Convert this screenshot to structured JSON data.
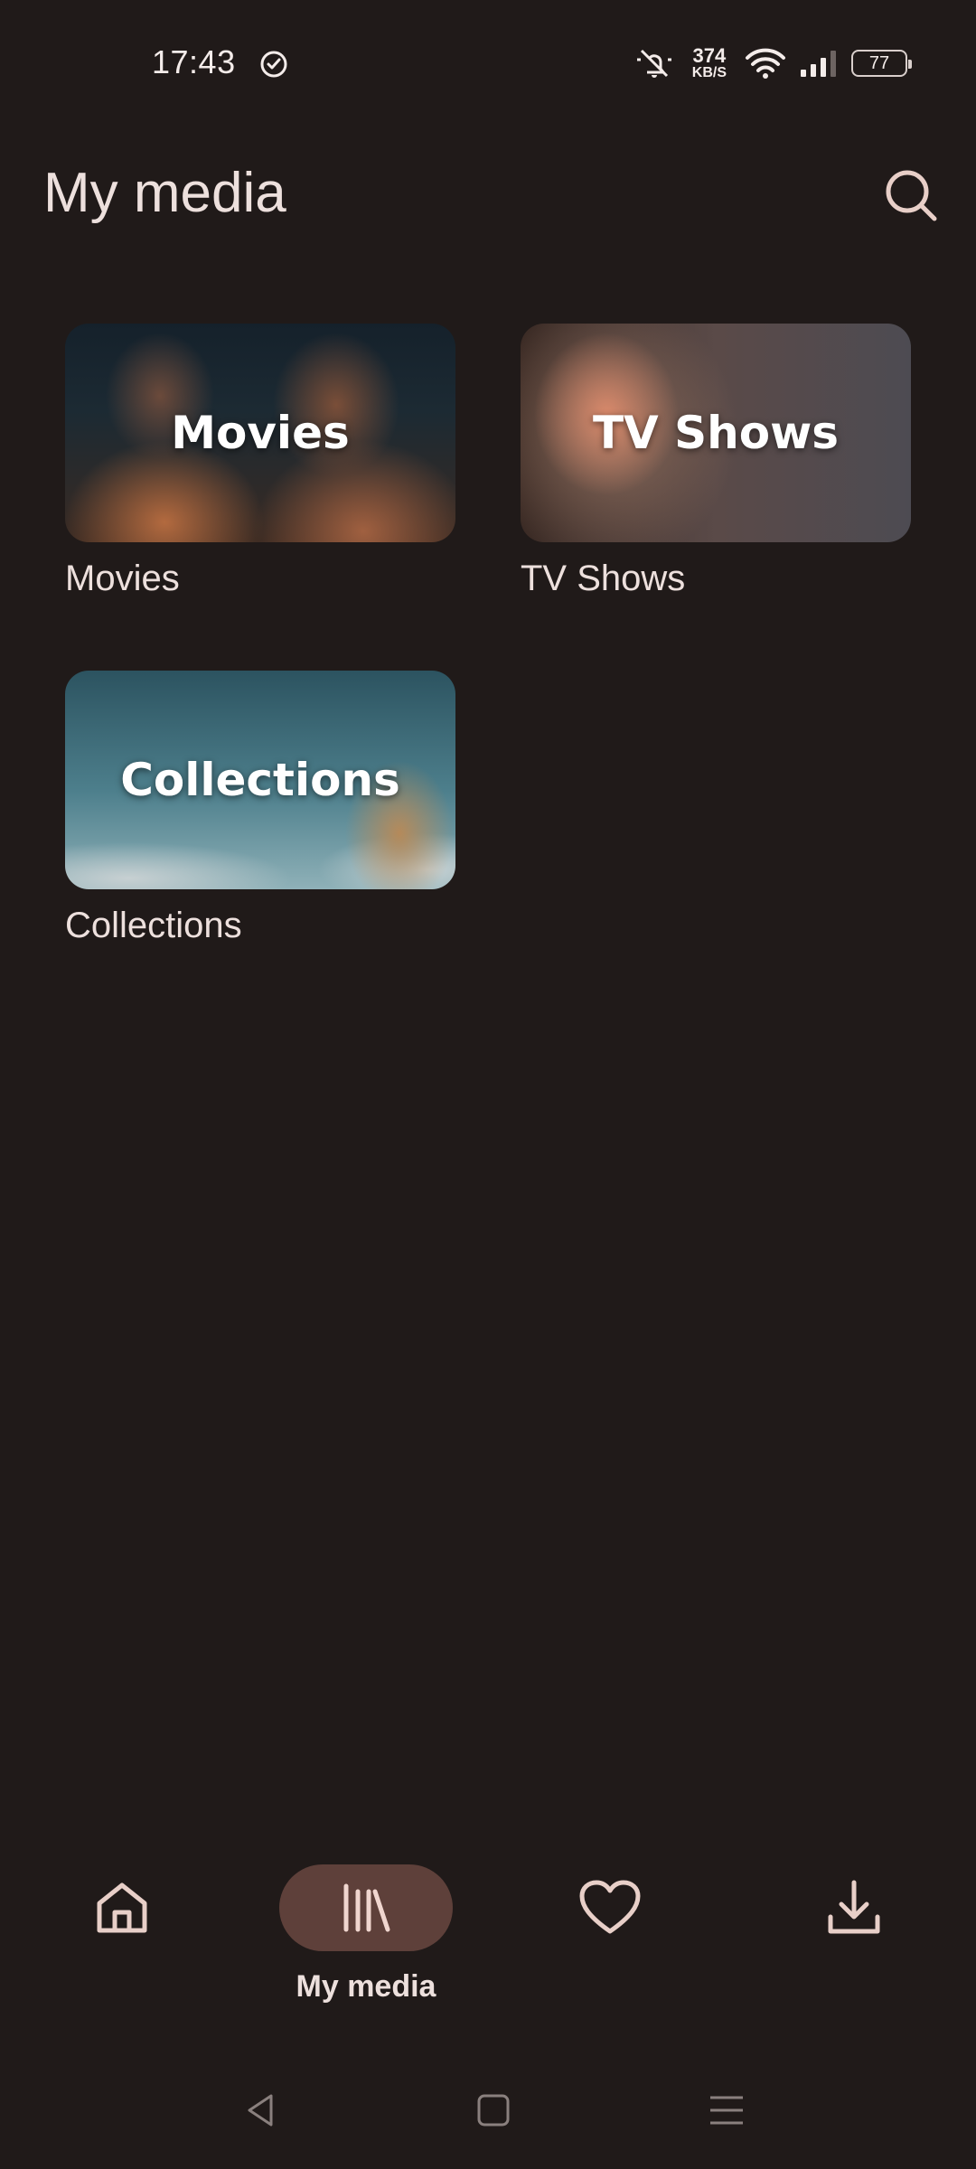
{
  "status_bar": {
    "time": "17:43",
    "net_speed_value": "374",
    "net_speed_unit": "KB/S",
    "battery": "77",
    "icons": [
      "check-circle-icon",
      "mute-icon",
      "wifi-icon",
      "signal-icon",
      "battery-icon"
    ]
  },
  "header": {
    "title": "My media",
    "search_icon": "search-icon"
  },
  "libraries": [
    {
      "overlay": "Movies",
      "label": "Movies"
    },
    {
      "overlay": "TV Shows",
      "label": "TV Shows"
    },
    {
      "overlay": "Collections",
      "label": "Collections"
    }
  ],
  "bottom_nav": {
    "active": "My media",
    "items": [
      {
        "icon": "home-icon",
        "label": ""
      },
      {
        "icon": "library-icon",
        "label": "My media"
      },
      {
        "icon": "heart-icon",
        "label": ""
      },
      {
        "icon": "download-icon",
        "label": ""
      }
    ]
  },
  "colors": {
    "background": "#201a19",
    "text": "#ede0dd",
    "active_pill": "#5e403a",
    "icon": "#e8cfc8"
  }
}
